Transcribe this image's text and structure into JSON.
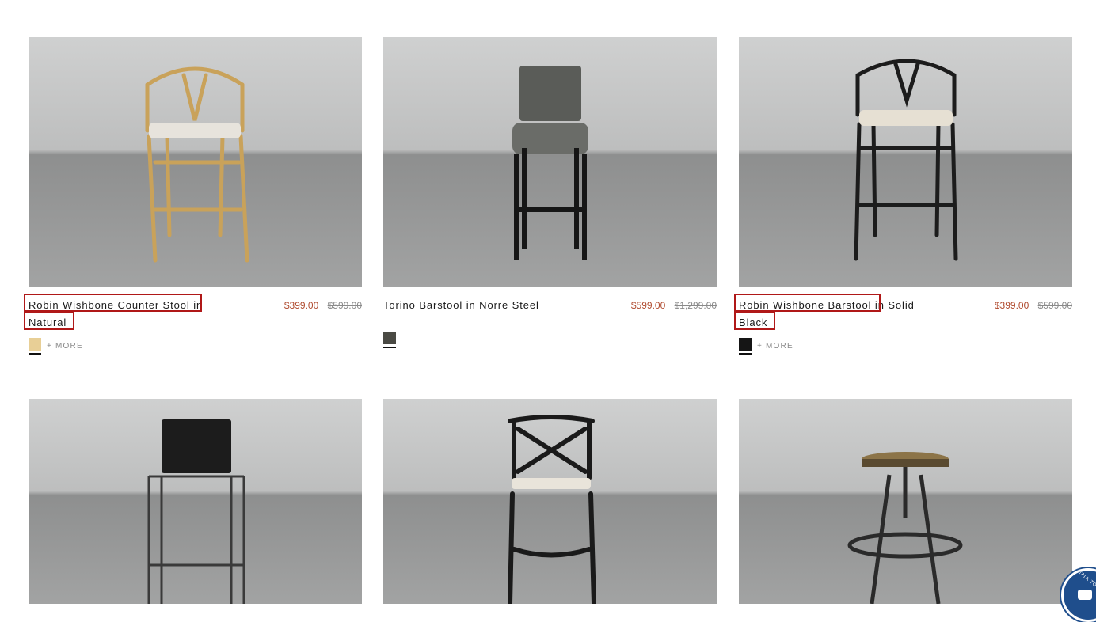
{
  "products": [
    {
      "title": "Robin Wishbone Counter Stool in Natural",
      "sale_price": "$399.00",
      "original_price": "$599.00",
      "more_label": "+ MORE",
      "swatch_color": "#e8cf96",
      "image_icon": "wishbone-stool-natural"
    },
    {
      "title": "Torino Barstool in Norre Steel",
      "sale_price": "$599.00",
      "original_price": "$1,299.00",
      "more_label": "",
      "swatch_color": "#4a4a44",
      "image_icon": "upholstered-barstool"
    },
    {
      "title": "Robin Wishbone Barstool in Solid Black",
      "sale_price": "$399.00",
      "original_price": "$599.00",
      "more_label": "+ MORE",
      "swatch_color": "#151515",
      "image_icon": "wishbone-barstool-black"
    },
    {
      "image_icon": "sling-counter-stool"
    },
    {
      "image_icon": "cross-back-barstool"
    },
    {
      "image_icon": "swivel-industrial-stool"
    }
  ],
  "chat_widget": {
    "label": "TALK TO",
    "icon": "chat-bubble-icon"
  }
}
